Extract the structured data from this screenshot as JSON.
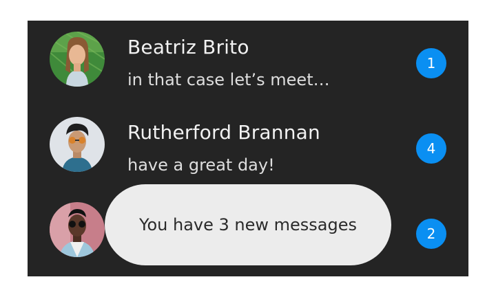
{
  "conversations": [
    {
      "name": "Beatriz Brito",
      "preview": "in that case let’s meet…",
      "unread": "1",
      "avatar_icon": "person-photo-avatar"
    },
    {
      "name": "Rutherford Brannan",
      "preview": "have a great day!",
      "unread": "4",
      "avatar_icon": "person-photo-avatar"
    },
    {
      "name": "",
      "preview": "",
      "unread": "2",
      "avatar_icon": "person-photo-avatar"
    }
  ],
  "toast": {
    "message": "You have 3 new messages"
  },
  "colors": {
    "panel_background": "#242424",
    "badge": "#0a8ff2",
    "toast_background": "#ececec",
    "name_text": "#f2f2f2"
  }
}
